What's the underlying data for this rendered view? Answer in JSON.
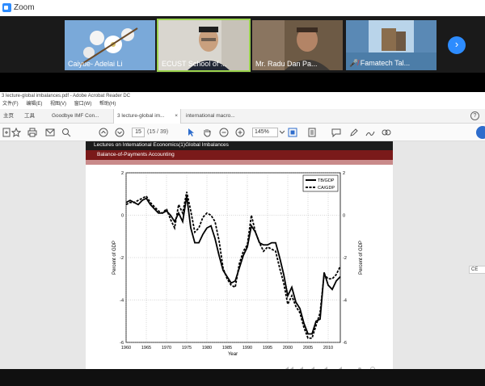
{
  "zoom": {
    "title": "Zoom",
    "participants": [
      {
        "name": "Caiyue- Adelai Li"
      },
      {
        "name": "ECUST School of ..."
      },
      {
        "name": "Mr. Radu Dan Pa..."
      },
      {
        "name": "Famatech Tal..."
      }
    ]
  },
  "acrobat": {
    "window_title": "3 lecture-global imbalances.pdf - Adobe Acrobat Reader DC",
    "menu": [
      "文件(F)",
      "编辑(E)",
      "视图(V)",
      "窗口(W)",
      "帮助(H)"
    ],
    "tabs": [
      "主页",
      "工具",
      "Goodbye IMF Con...",
      "3 lecture-global im...",
      "international macro..."
    ],
    "tab_close": "×",
    "page_number": "15",
    "page_total": "(15 / 39)",
    "zoom_level": "145%",
    "side_chip": "CE"
  },
  "slide": {
    "header_title": "Lectures on International Economics(1)Global Imbalances",
    "header_subtitle": "Balance-of-Payments Accounting"
  },
  "chart_data": {
    "type": "line",
    "xlabel": "Year",
    "ylabel": "Percent of GDP",
    "ylabel_right": "Percent of GDP",
    "xlim": [
      1960,
      2013
    ],
    "ylim": [
      -6,
      2
    ],
    "xticks": [
      1960,
      1965,
      1970,
      1975,
      1980,
      1985,
      1990,
      1995,
      2000,
      2005,
      2010
    ],
    "yticks": [
      -6,
      -4,
      -2,
      0,
      2
    ],
    "grid": true,
    "legend_position": "top-right",
    "series": [
      {
        "name": "TB/GDP",
        "style": "solid",
        "x": [
          1960,
          1961,
          1962,
          1963,
          1964,
          1965,
          1966,
          1967,
          1968,
          1969,
          1970,
          1971,
          1972,
          1973,
          1974,
          1975,
          1976,
          1977,
          1978,
          1979,
          1980,
          1981,
          1982,
          1983,
          1984,
          1985,
          1986,
          1987,
          1988,
          1989,
          1990,
          1991,
          1992,
          1993,
          1994,
          1995,
          1996,
          1997,
          1998,
          1999,
          2000,
          2001,
          2002,
          2003,
          2004,
          2005,
          2006,
          2007,
          2008,
          2009,
          2010,
          2011,
          2012,
          2013
        ],
        "y": [
          0.6,
          0.7,
          0.6,
          0.5,
          0.7,
          0.8,
          0.5,
          0.3,
          0.1,
          0.1,
          0.2,
          0.0,
          -0.3,
          0.1,
          -0.3,
          0.9,
          -0.6,
          -1.3,
          -1.3,
          -0.9,
          -0.6,
          -0.5,
          -1.1,
          -1.9,
          -2.6,
          -2.9,
          -3.2,
          -3.1,
          -2.5,
          -1.9,
          -1.5,
          -0.5,
          -0.8,
          -1.3,
          -1.4,
          -1.4,
          -1.3,
          -1.3,
          -2.0,
          -2.8,
          -3.8,
          -3.4,
          -4.1,
          -4.4,
          -5.1,
          -5.6,
          -5.6,
          -5.0,
          -4.9,
          -2.7,
          -3.3,
          -3.5,
          -3.1,
          -2.9
        ]
      },
      {
        "name": "CA/GDP",
        "style": "dashed",
        "x": [
          1960,
          1961,
          1962,
          1963,
          1964,
          1965,
          1966,
          1967,
          1968,
          1969,
          1970,
          1971,
          1972,
          1973,
          1974,
          1975,
          1976,
          1977,
          1978,
          1979,
          1980,
          1981,
          1982,
          1983,
          1984,
          1985,
          1986,
          1987,
          1988,
          1989,
          1990,
          1991,
          1992,
          1993,
          1994,
          1995,
          1996,
          1997,
          1998,
          1999,
          2000,
          2001,
          2002,
          2003,
          2004,
          2005,
          2006,
          2007,
          2008,
          2009,
          2010,
          2011,
          2012,
          2013
        ],
        "y": [
          0.5,
          0.6,
          0.6,
          0.7,
          0.8,
          0.9,
          0.6,
          0.4,
          0.2,
          0.1,
          0.3,
          -0.2,
          -0.6,
          0.5,
          0.1,
          1.1,
          0.2,
          -0.8,
          -0.6,
          -0.1,
          0.1,
          0.0,
          -0.3,
          -1.2,
          -2.5,
          -3.0,
          -3.3,
          -3.4,
          -2.3,
          -1.7,
          -1.4,
          0.0,
          -0.8,
          -1.3,
          -1.7,
          -1.5,
          -1.6,
          -1.7,
          -2.5,
          -3.2,
          -4.2,
          -3.8,
          -4.3,
          -4.6,
          -5.3,
          -5.8,
          -5.8,
          -5.2,
          -4.6,
          -2.8,
          -3.0,
          -3.0,
          -2.8,
          -2.4
        ]
      }
    ]
  }
}
